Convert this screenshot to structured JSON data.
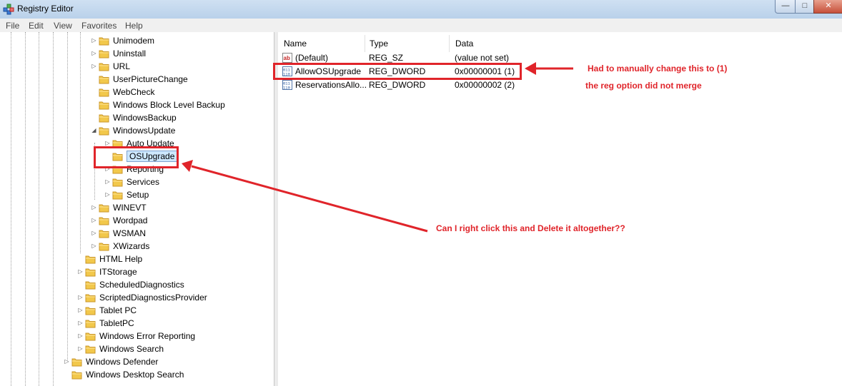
{
  "window": {
    "title": "Registry Editor",
    "controls": {
      "minimize": "—",
      "maximize": "□",
      "close": "✕"
    }
  },
  "menu": [
    "File",
    "Edit",
    "View",
    "Favorites",
    "Help"
  ],
  "tree": [
    {
      "label": "Unimodem",
      "expander": "▷"
    },
    {
      "label": "Uninstall",
      "expander": "▷"
    },
    {
      "label": "URL",
      "expander": "▷"
    },
    {
      "label": "UserPictureChange",
      "expander": ""
    },
    {
      "label": "WebCheck",
      "expander": ""
    },
    {
      "label": "Windows Block Level Backup",
      "expander": ""
    },
    {
      "label": "WindowsBackup",
      "expander": ""
    },
    {
      "label": "WindowsUpdate",
      "expander": "◢"
    },
    {
      "label": "Auto Update",
      "expander": "▷"
    },
    {
      "label": "OSUpgrade",
      "expander": "",
      "selected": true
    },
    {
      "label": "Reporting",
      "expander": "▷"
    },
    {
      "label": "Services",
      "expander": "▷"
    },
    {
      "label": "Setup",
      "expander": "▷"
    },
    {
      "label": "WINEVT",
      "expander": "▷"
    },
    {
      "label": "Wordpad",
      "expander": "▷"
    },
    {
      "label": "WSMAN",
      "expander": "▷"
    },
    {
      "label": "XWizards",
      "expander": "▷"
    },
    {
      "label": "HTML Help",
      "expander": ""
    },
    {
      "label": "ITStorage",
      "expander": "▷"
    },
    {
      "label": "ScheduledDiagnostics",
      "expander": ""
    },
    {
      "label": "ScriptedDiagnosticsProvider",
      "expander": "▷"
    },
    {
      "label": "Tablet PC",
      "expander": "▷"
    },
    {
      "label": "TabletPC",
      "expander": "▷"
    },
    {
      "label": "Windows Error Reporting",
      "expander": "▷"
    },
    {
      "label": "Windows Search",
      "expander": "▷"
    },
    {
      "label": "Windows Defender",
      "expander": "▷"
    },
    {
      "label": "Windows Desktop Search",
      "expander": ""
    }
  ],
  "list": {
    "columns": [
      "Name",
      "Type",
      "Data"
    ],
    "rows": [
      {
        "icon": "string-value-icon",
        "name": "(Default)",
        "type": "REG_SZ",
        "data": "(value not set)"
      },
      {
        "icon": "dword-value-icon",
        "name": "AllowOSUpgrade",
        "type": "REG_DWORD",
        "data": "0x00000001 (1)"
      },
      {
        "icon": "dword-value-icon",
        "name": "ReservationsAllo...",
        "type": "REG_DWORD",
        "data": "0x00000002 (2)"
      }
    ]
  },
  "annotations": {
    "note1": "Had to manually change this to (1)",
    "note2": "the reg option did not merge",
    "note3": "Can I right click this and Delete it altogether??",
    "color": "#e0242a"
  },
  "colors": {
    "folder": "#f2c84b",
    "folder_edge": "#c9962a",
    "selection": "#cde8ff"
  }
}
